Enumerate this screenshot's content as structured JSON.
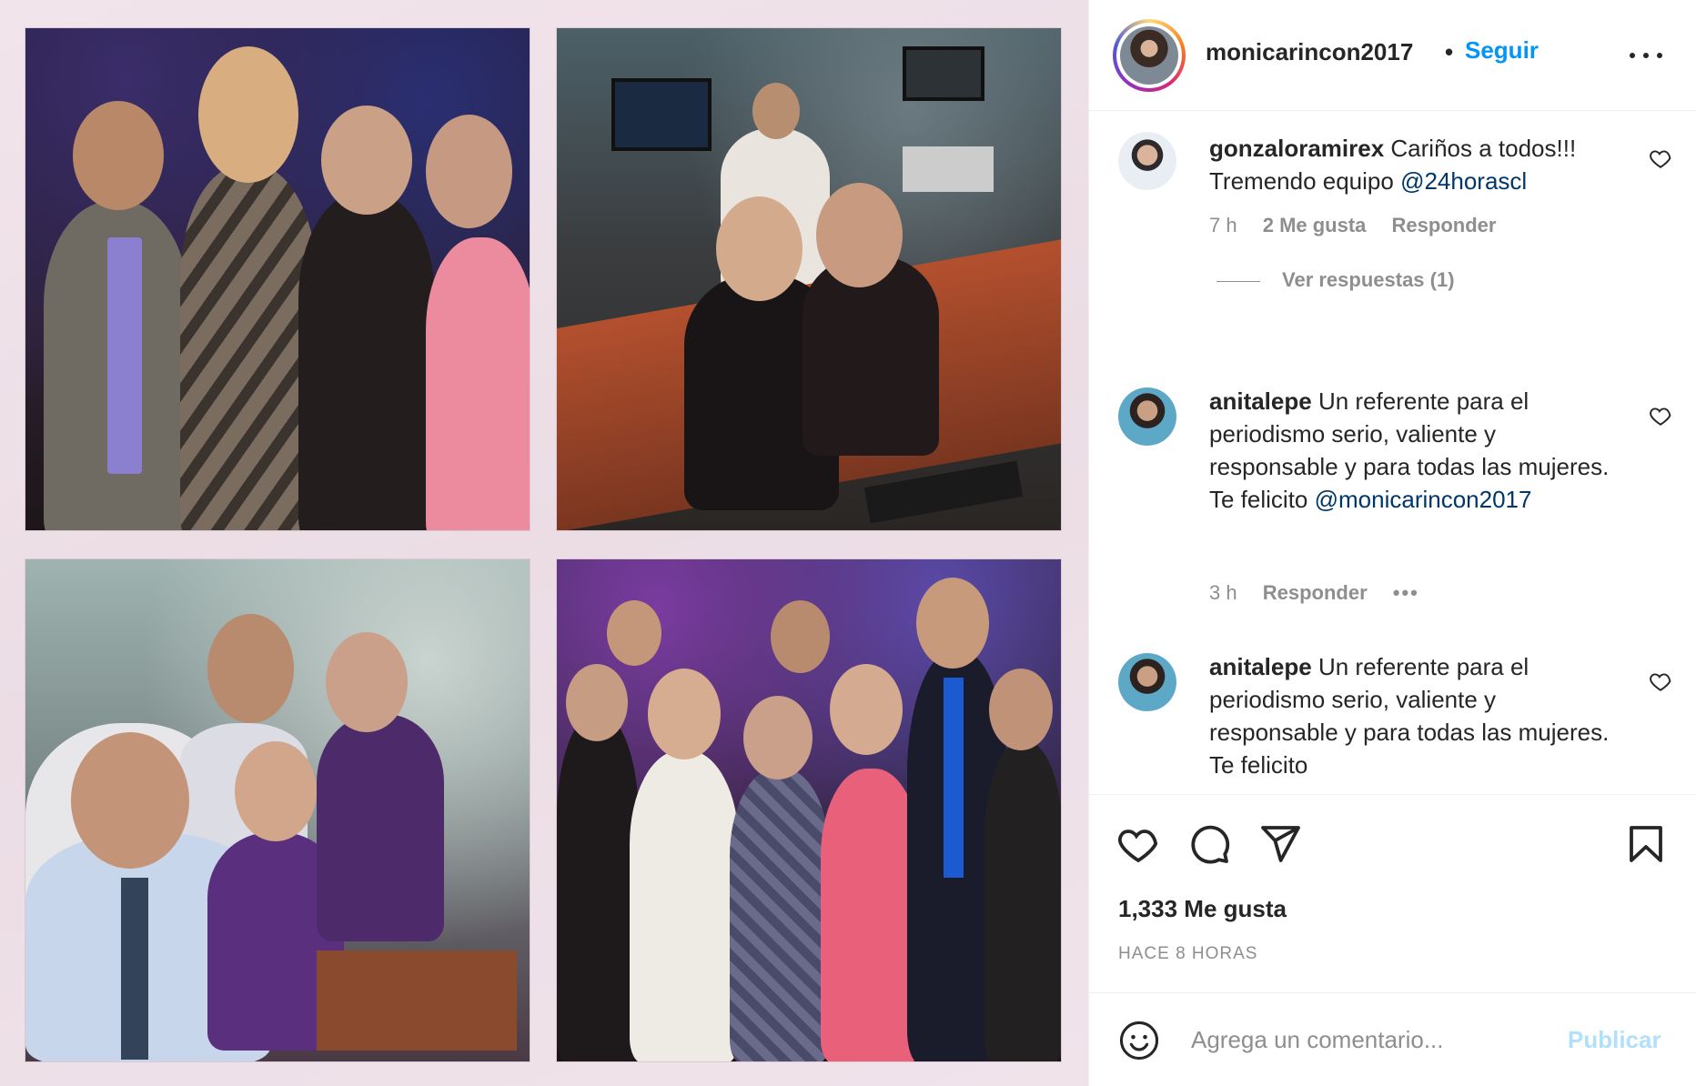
{
  "post": {
    "username": "monicarincon2017",
    "separator": "•",
    "follow_label": "Seguir",
    "more_icon": "more-horizontal-icon"
  },
  "comments": [
    {
      "user": "gonzaloramirex",
      "text": "Cariños a todos!!! Tremendo equipo ",
      "mention": "@24horascl",
      "time": "7 h",
      "likes": "2 Me gusta",
      "reply_label": "Responder",
      "view_replies": "Ver respuestas (1)"
    },
    {
      "user": "anitalepe",
      "text": "Un referente para el periodismo serio, valiente y responsable y para todas las mujeres. Te felicito ",
      "mention": "@monicarincon2017",
      "time": "3 h",
      "reply_label": "Responder"
    },
    {
      "user": "anitalepe",
      "text": "Un referente para el periodismo serio, valiente y responsable y para todas las mujeres. Te felicito",
      "mention": ""
    }
  ],
  "actions": {
    "likes_count": "1,333 Me gusta",
    "timestamp": "HACE 8 HORAS"
  },
  "composer": {
    "placeholder": "Agrega un comentario...",
    "publish_label": "Publicar"
  },
  "colors": {
    "accent": "#0095f6",
    "mention": "#00376b",
    "muted": "#8e8e8e",
    "publish_disabled": "#b2dffc"
  }
}
